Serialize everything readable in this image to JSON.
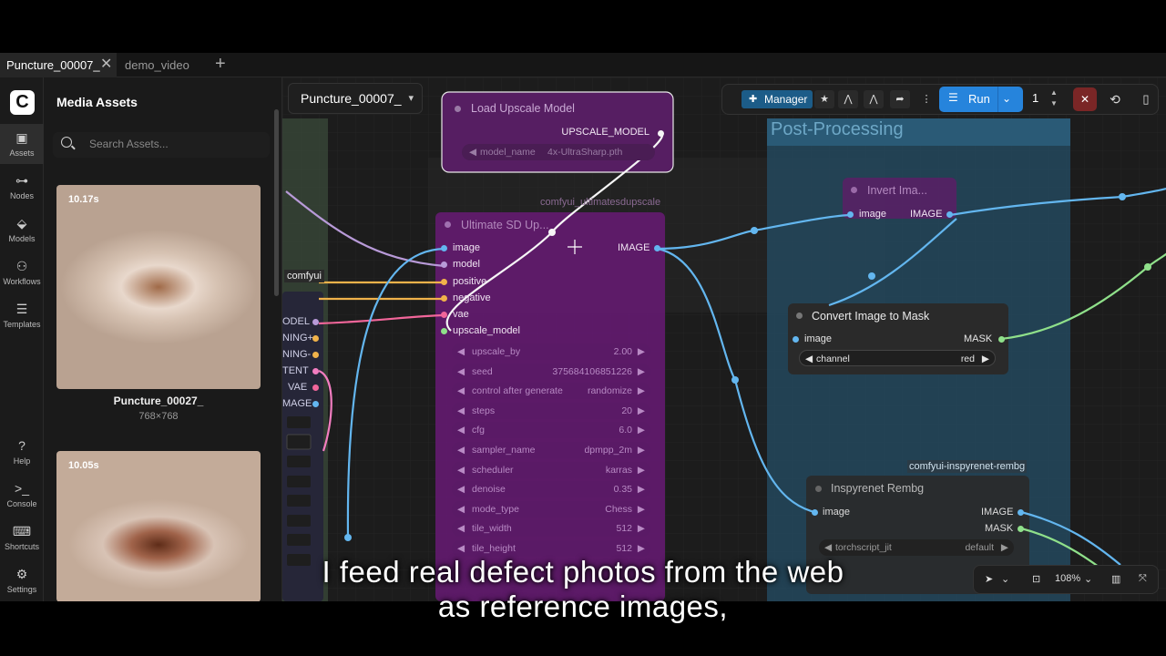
{
  "tabs": [
    {
      "label": "Puncture_00007_",
      "active": true
    },
    {
      "label": "demo_video",
      "active": false
    }
  ],
  "sidebar": {
    "items": [
      {
        "label": "Assets",
        "icon": "image-icon",
        "active": true
      },
      {
        "label": "Nodes",
        "icon": "nodes-icon"
      },
      {
        "label": "Models",
        "icon": "models-icon"
      },
      {
        "label": "Workflows",
        "icon": "workflows-icon"
      },
      {
        "label": "Templates",
        "icon": "templates-icon"
      }
    ],
    "bottom": [
      {
        "label": "Help",
        "icon": "help-icon"
      },
      {
        "label": "Console",
        "icon": "console-icon"
      },
      {
        "label": "Shortcuts",
        "icon": "keyboard-icon"
      },
      {
        "label": "Settings",
        "icon": "gear-icon"
      }
    ]
  },
  "assets": {
    "title": "Media Assets",
    "search_placeholder": "Search Assets...",
    "cards": [
      {
        "duration": "10.17s",
        "name": "Puncture_00027_",
        "dims": "768×768"
      },
      {
        "duration": "10.05s"
      }
    ]
  },
  "graph_tab": {
    "label": "Puncture_00007_"
  },
  "toolbar": {
    "manager_label": "Manager",
    "run_label": "Run",
    "batch_count": "1"
  },
  "nodes": {
    "load_upscale": {
      "title": "Load Upscale Model",
      "output": "UPSCALE_MODEL",
      "widget_name": "model_name",
      "widget_value": "4x-UltraSharp.pth"
    },
    "ultimate_sd": {
      "pack": "comfyui_ultimatesdupscale",
      "title": "Ultimate SD Up...",
      "inputs": [
        "image",
        "model",
        "positive",
        "negative",
        "vae",
        "upscale_model"
      ],
      "output": "IMAGE",
      "widgets": [
        {
          "name": "upscale_by",
          "value": "2.00"
        },
        {
          "name": "seed",
          "value": "375684106851226"
        },
        {
          "name": "control after generate",
          "value": "randomize"
        },
        {
          "name": "steps",
          "value": "20"
        },
        {
          "name": "cfg",
          "value": "6.0"
        },
        {
          "name": "sampler_name",
          "value": "dpmpp_2m"
        },
        {
          "name": "scheduler",
          "value": "karras"
        },
        {
          "name": "denoise",
          "value": "0.35"
        },
        {
          "name": "mode_type",
          "value": "Chess"
        },
        {
          "name": "tile_width",
          "value": "512"
        },
        {
          "name": "tile_height",
          "value": "512"
        }
      ]
    },
    "left_partial": {
      "pack": "comfyui",
      "outputs": [
        "ODEL",
        "NING+",
        "NING-",
        "TENT",
        "VAE",
        "MAGE"
      ]
    },
    "invert": {
      "title": "Invert Ima...",
      "input": "image",
      "output": "IMAGE"
    },
    "convert_mask": {
      "title": "Convert Image to Mask",
      "input": "image",
      "output": "MASK",
      "widget_name": "channel",
      "widget_value": "red"
    },
    "inspyrenet": {
      "pack": "comfyui-inspyrenet-rembg",
      "title": "Inspyrenet Rembg",
      "input": "image",
      "outputs": [
        "IMAGE",
        "MASK"
      ],
      "widget_name": "torchscript_jit",
      "widget_value": "default"
    }
  },
  "groups": {
    "post_processing": "Post-Processing"
  },
  "zoom": {
    "level": "108%"
  },
  "subtitle": {
    "line1": "I feed real defect photos from the web",
    "line2": "as reference images,"
  }
}
